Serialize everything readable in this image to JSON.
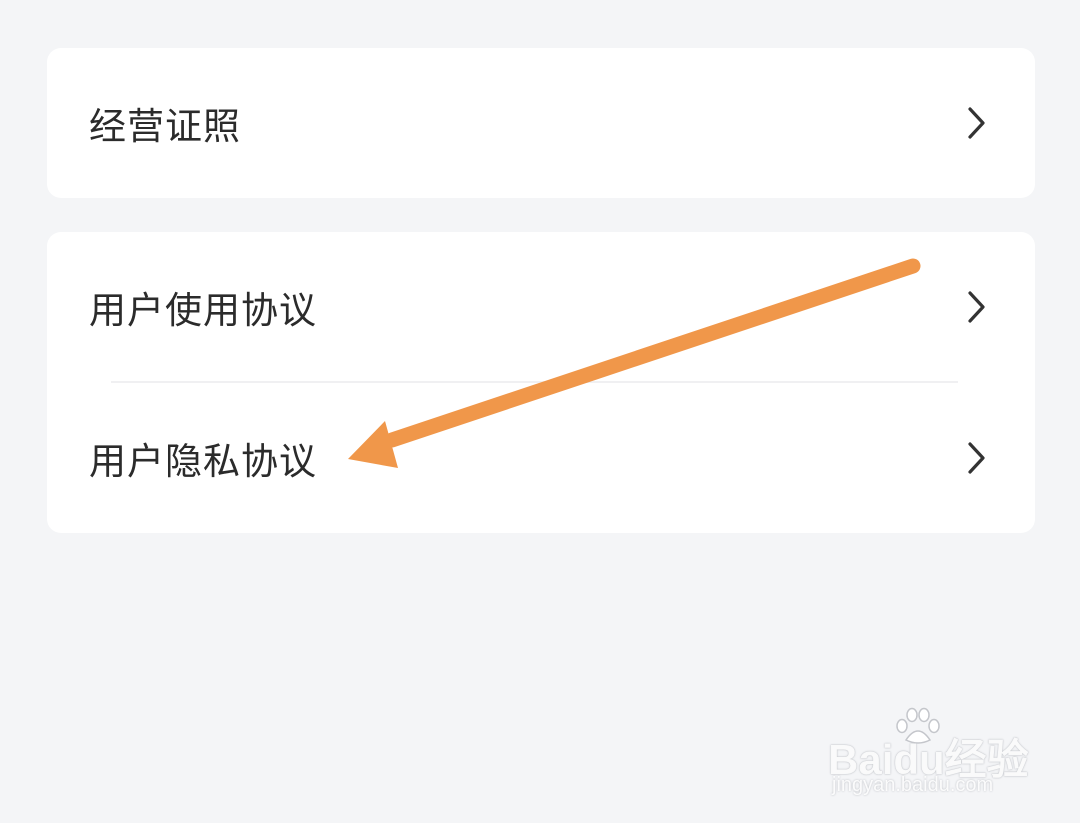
{
  "menu": {
    "license_label": "经营证照",
    "user_agreement_label": "用户使用协议",
    "privacy_agreement_label": "用户隐私协议"
  },
  "annotation": {
    "arrow_color": "#f0974a"
  },
  "watermark": {
    "logo_text": "Baidu经验",
    "url_text": "jingyan.baidu.com"
  },
  "colors": {
    "background": "#f4f5f7",
    "card": "#ffffff",
    "text": "#2b2b2b",
    "chevron": "#333333"
  }
}
